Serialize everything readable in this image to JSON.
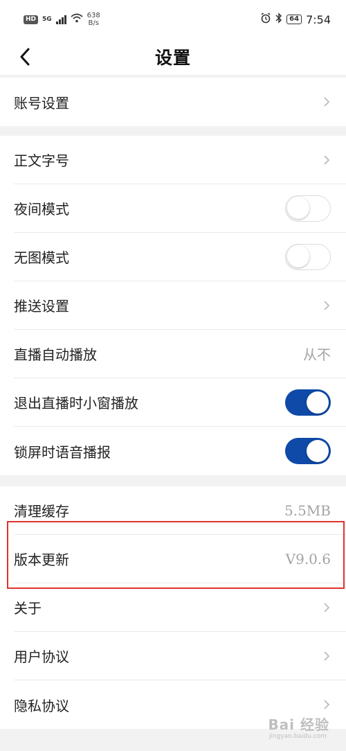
{
  "status_bar": {
    "hd": "HD",
    "net_gen": "5G",
    "net_speed_value": "638",
    "net_speed_unit": "B/s",
    "battery": "64",
    "time": "7:54"
  },
  "header": {
    "title": "设置",
    "back_icon": "chevron-left-icon"
  },
  "groups": [
    {
      "items": [
        {
          "label": "账号设置",
          "type": "link"
        }
      ]
    },
    {
      "items": [
        {
          "label": "正文字号",
          "type": "link"
        },
        {
          "label": "夜间模式",
          "type": "toggle",
          "on": false
        },
        {
          "label": "无图模式",
          "type": "toggle",
          "on": false
        },
        {
          "label": "推送设置",
          "type": "link"
        },
        {
          "label": "直播自动播放",
          "type": "value",
          "value": "从不"
        },
        {
          "label": "退出直播时小窗播放",
          "type": "toggle",
          "on": true
        },
        {
          "label": "锁屏时语音播报",
          "type": "toggle",
          "on": true
        }
      ]
    },
    {
      "items": [
        {
          "label": "清理缓存",
          "type": "value",
          "value": "5.5MB"
        },
        {
          "label": "版本更新",
          "type": "value",
          "value": "V9.0.6"
        },
        {
          "label": "关于",
          "type": "link"
        },
        {
          "label": "用户协议",
          "type": "link"
        },
        {
          "label": "隐私协议",
          "type": "link"
        }
      ]
    }
  ],
  "watermark": {
    "text": "Bai 经验",
    "sub": "jingyan.baidu.com"
  },
  "colors": {
    "toggle_on": "#0f4aa8",
    "highlight_border": "#e0312c",
    "background": "#f2f2f2"
  }
}
